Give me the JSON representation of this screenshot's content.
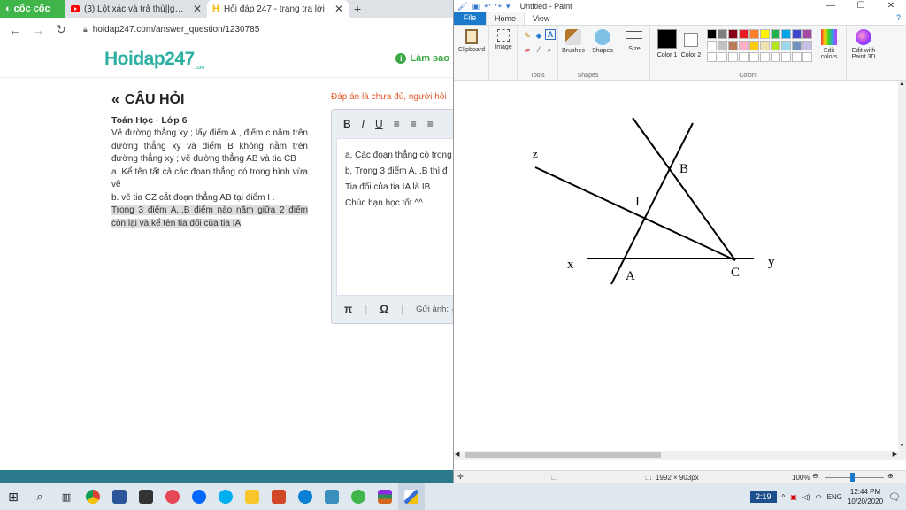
{
  "browser": {
    "brand": "cốc cốc",
    "tabs": [
      {
        "title": "(3) Lột xác và trả thù||gacha li",
        "icon": "youtube-icon"
      },
      {
        "title": "Hỏi đáp 247 - trang tra lời",
        "icon": "hoidap-icon"
      }
    ],
    "url": "hoidap247.com/answer_question/1230785"
  },
  "site": {
    "logo_main": "Hoidap247",
    "logo_sub": ".com",
    "thank_label": "Làm sao"
  },
  "question": {
    "heading": "CÂU HỎI",
    "subject": "Toán Học · Lớp 6",
    "body": [
      "Vẽ đường thẳng xy ; lấy điểm A , điểm c nằm trên đường thẳng xy và điểm B không nằm trên đường thẳng xy ; vẽ đường thẳng AB và tia CB",
      "a. Kể tên tất cả các đoạn thẳng có trong hình vừa vẽ",
      "b. vẽ tia CZ cắt đoạn thẳng AB tại điểm I ."
    ],
    "highlight": "Trong 3 điểm A,I,B điểm nào nằm giữa 2 điểm còn lại và kể tên tia đối của tia IA"
  },
  "answer": {
    "note": "Đáp án là chưa đủ, người hỏi",
    "toolbar": [
      "B",
      "I",
      "U",
      "≡",
      "≡",
      "≡"
    ],
    "lines": [
      "a, Các đoạn thẳng có trong",
      "b, Trong 3 điểm A,I,B thì đ",
      "Tia đối của tia IA là IB.",
      "Chúc bạn học tốt ^^"
    ],
    "bottom_pi": "π",
    "bottom_omega": "Ω",
    "attach_label": "Gửi ảnh:"
  },
  "paint": {
    "title": "Untitled - Paint",
    "tabs": {
      "file": "File",
      "home": "Home",
      "view": "View"
    },
    "groups": {
      "clipboard": "Clipboard",
      "image": "Image",
      "tools": "Tools",
      "brushes": "Brushes",
      "shapes": "Shapes",
      "size": "Size",
      "color1": "Color 1",
      "color2": "Color 2",
      "colors": "Colors",
      "edit_colors": "Edit colors",
      "edit_paint3d": "Edit with Paint 3D"
    },
    "palette": [
      "#000000",
      "#7f7f7f",
      "#880015",
      "#ed1c24",
      "#ff7f27",
      "#fff200",
      "#22b14c",
      "#00a2e8",
      "#3f48cc",
      "#a349a4",
      "#ffffff",
      "#c3c3c3",
      "#b97a57",
      "#ffaec9",
      "#ffc90e",
      "#efe4b0",
      "#b5e61d",
      "#99d9ea",
      "#7092be",
      "#c8bfe7"
    ],
    "labels": {
      "z": "z",
      "b": "B",
      "i": "I",
      "x": "x",
      "a": "A",
      "c": "C",
      "y": "y"
    },
    "status": {
      "size": "1992 × 903px",
      "zoom": "100%"
    }
  },
  "taskbar": {
    "battery": "2:19",
    "lang": "ENG",
    "time": "12:44 PM",
    "date": "10/20/2020"
  }
}
